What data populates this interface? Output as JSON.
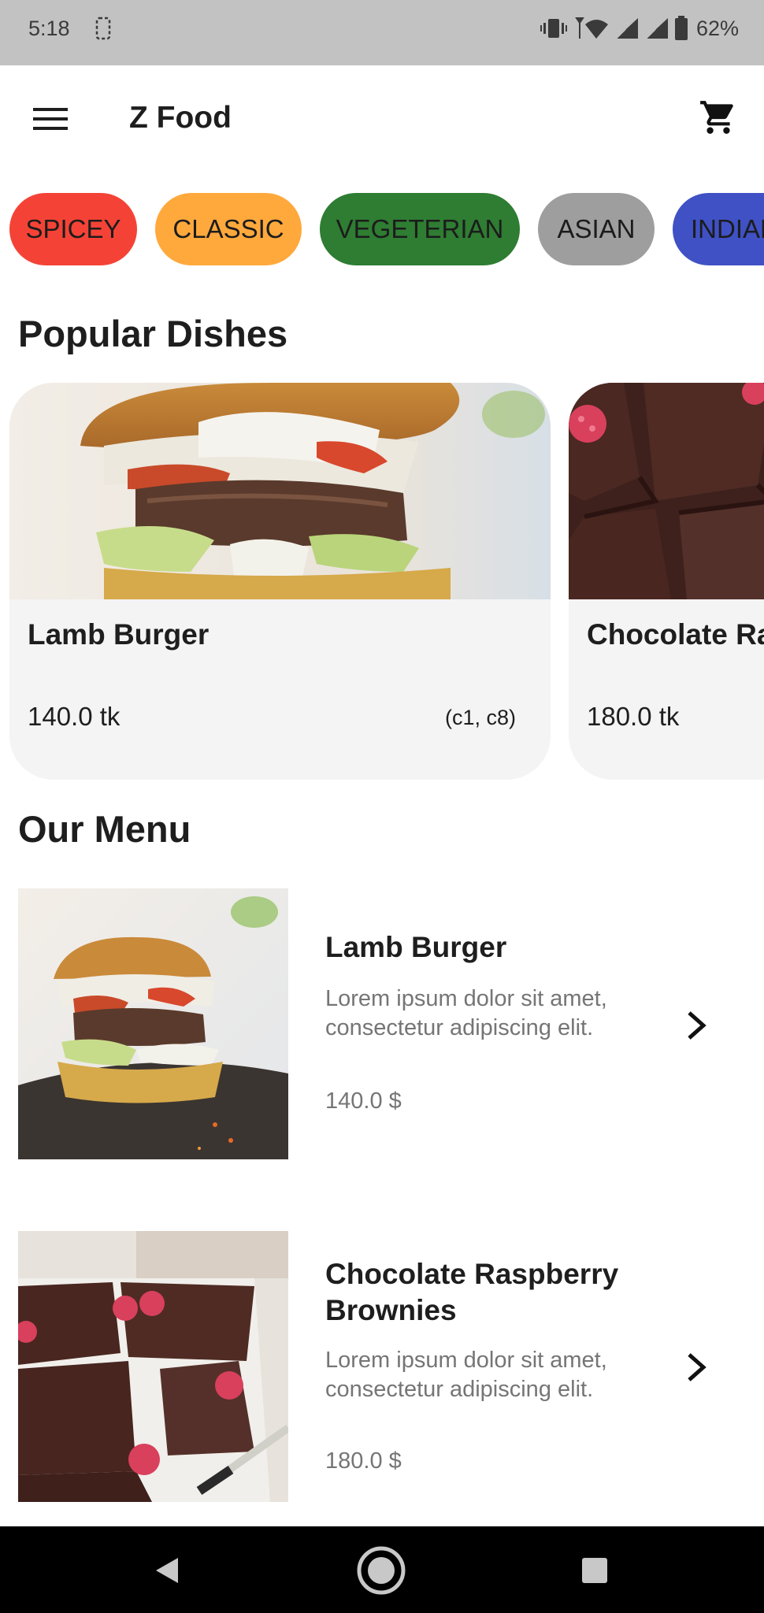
{
  "status_bar": {
    "time": "5:18",
    "battery": "62%",
    "icons": [
      "screenshot-icon",
      "vibrate-icon",
      "wifi-icon",
      "signal-icon",
      "signal-icon",
      "battery-icon"
    ]
  },
  "app_bar": {
    "title": "Z Food",
    "icons": [
      "hamburger-menu-icon",
      "shopping-cart-icon"
    ]
  },
  "categories": [
    {
      "label": "SPICEY",
      "color": "#f44336"
    },
    {
      "label": "CLASSIC",
      "color": "#ffa93d"
    },
    {
      "label": "VEGETERIAN",
      "color": "#2e7d32"
    },
    {
      "label": "ASIAN",
      "color": "#9e9e9e"
    },
    {
      "label": "INDIAN",
      "color": "#3f51c5"
    }
  ],
  "popular": {
    "title": "Popular Dishes",
    "items": [
      {
        "name": "Lamb Burger",
        "price": "140.0 tk",
        "tags": "(c1, c8)"
      },
      {
        "name": "Chocolate Ra",
        "price": "180.0 tk"
      }
    ]
  },
  "menu": {
    "title": "Our Menu",
    "items": [
      {
        "name": "Lamb Burger",
        "description": "Lorem ipsum dolor sit amet, consectetur adipiscing elit.",
        "price": "140.0 $"
      },
      {
        "name": "Chocolate Raspberry Brownies",
        "description": "Lorem ipsum dolor sit amet, consectetur adipiscing elit.",
        "price": "180.0 $"
      }
    ]
  },
  "nav_bar": {
    "icons": [
      "back-icon",
      "home-icon",
      "recents-icon"
    ]
  }
}
